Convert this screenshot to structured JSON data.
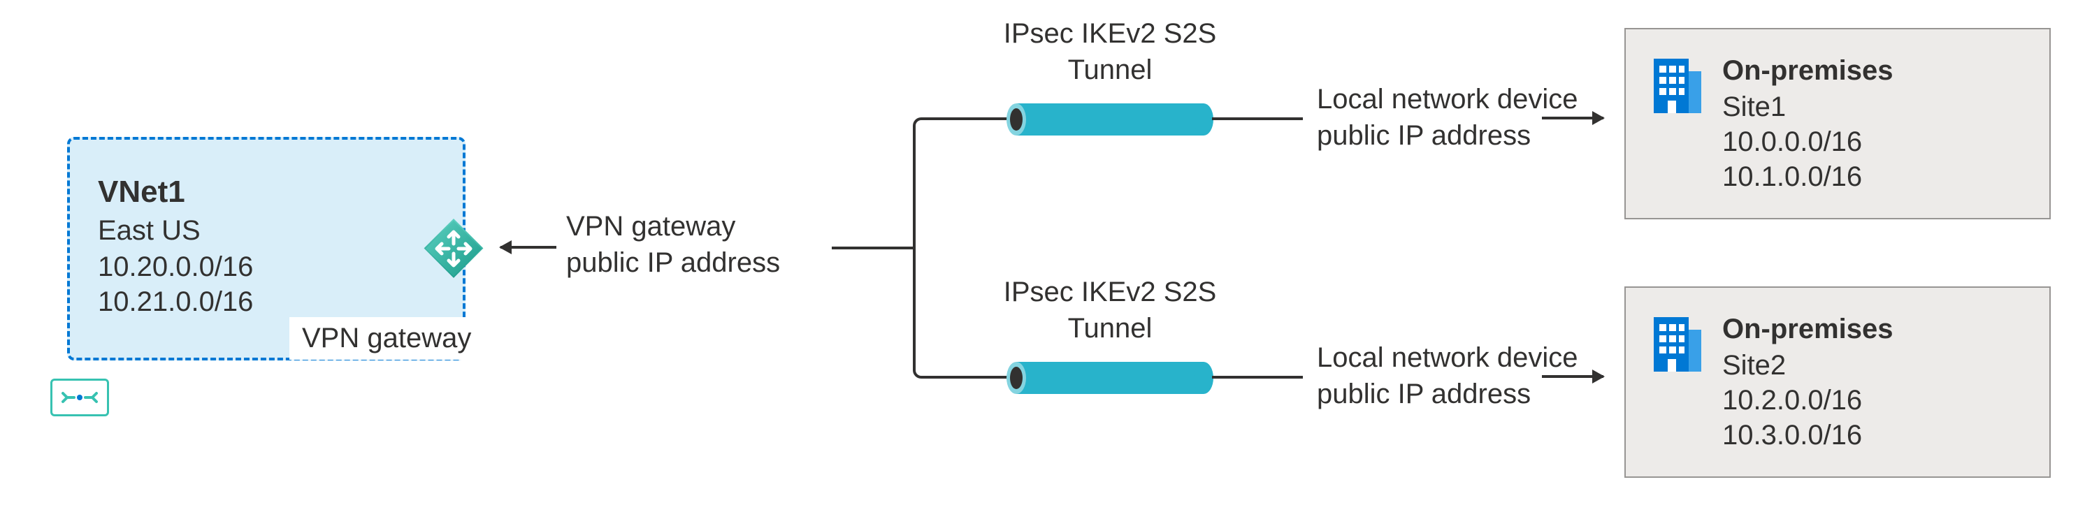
{
  "vnet": {
    "name": "VNet1",
    "region": "East US",
    "subnets": [
      "10.20.0.0/16",
      "10.21.0.0/16"
    ]
  },
  "vpn_gateway": {
    "label": "VPN gateway",
    "public_ip_label": "VPN gateway\npublic IP address"
  },
  "tunnels": {
    "top_label": "IPsec IKEv2 S2S\nTunnel",
    "bottom_label": "IPsec IKEv2 S2S\nTunnel"
  },
  "local_device": {
    "top_label": "Local network device\npublic IP address",
    "bottom_label": "Local network device\npublic IP address"
  },
  "sites": {
    "top": {
      "title": "On-premises",
      "name": "Site1",
      "subnets": [
        "10.0.0.0/16",
        "10.1.0.0/16"
      ]
    },
    "bottom": {
      "title": "On-premises",
      "name": "Site2",
      "subnets": [
        "10.2.0.0/16",
        "10.3.0.0/16"
      ]
    }
  },
  "colors": {
    "azure_blue": "#0078d4",
    "teal": "#37c2b1",
    "vnet_bg": "#d9eef9",
    "tunnel_fill": "#28b3cb",
    "site_bg": "#edebe9",
    "text": "#323130"
  }
}
